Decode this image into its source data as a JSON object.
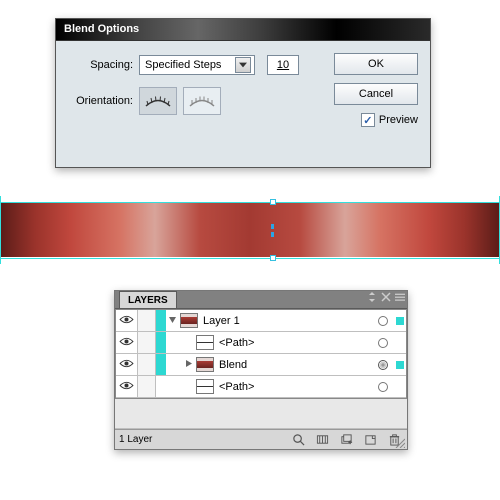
{
  "dialog": {
    "title": "Blend Options",
    "spacing_label": "Spacing:",
    "spacing_value": "Specified Steps",
    "steps_value": "10",
    "orientation_label": "Orientation:",
    "ok_label": "OK",
    "cancel_label": "Cancel",
    "preview_label": "Preview",
    "preview_checked": true
  },
  "layers_panel": {
    "tab": "LAYERS",
    "rows": [
      {
        "label": "Layer 1",
        "swatch": "#2dd8d2",
        "thumb": "grad",
        "disclosure": "down",
        "indent": 0,
        "target": true,
        "sel": true
      },
      {
        "label": "<Path>",
        "swatch": "#2dd8d2",
        "thumb": "line",
        "disclosure": "",
        "indent": 1,
        "target": false,
        "sel": false
      },
      {
        "label": "Blend",
        "swatch": "#2dd8d2",
        "thumb": "grad",
        "disclosure": "right",
        "indent": 1,
        "target": true,
        "sel": true,
        "active": true
      },
      {
        "label": "<Path>",
        "swatch": "#ffffff",
        "thumb": "line",
        "disclosure": "",
        "indent": 1,
        "target": false,
        "sel": false
      }
    ],
    "status_text": "1 Layer"
  }
}
